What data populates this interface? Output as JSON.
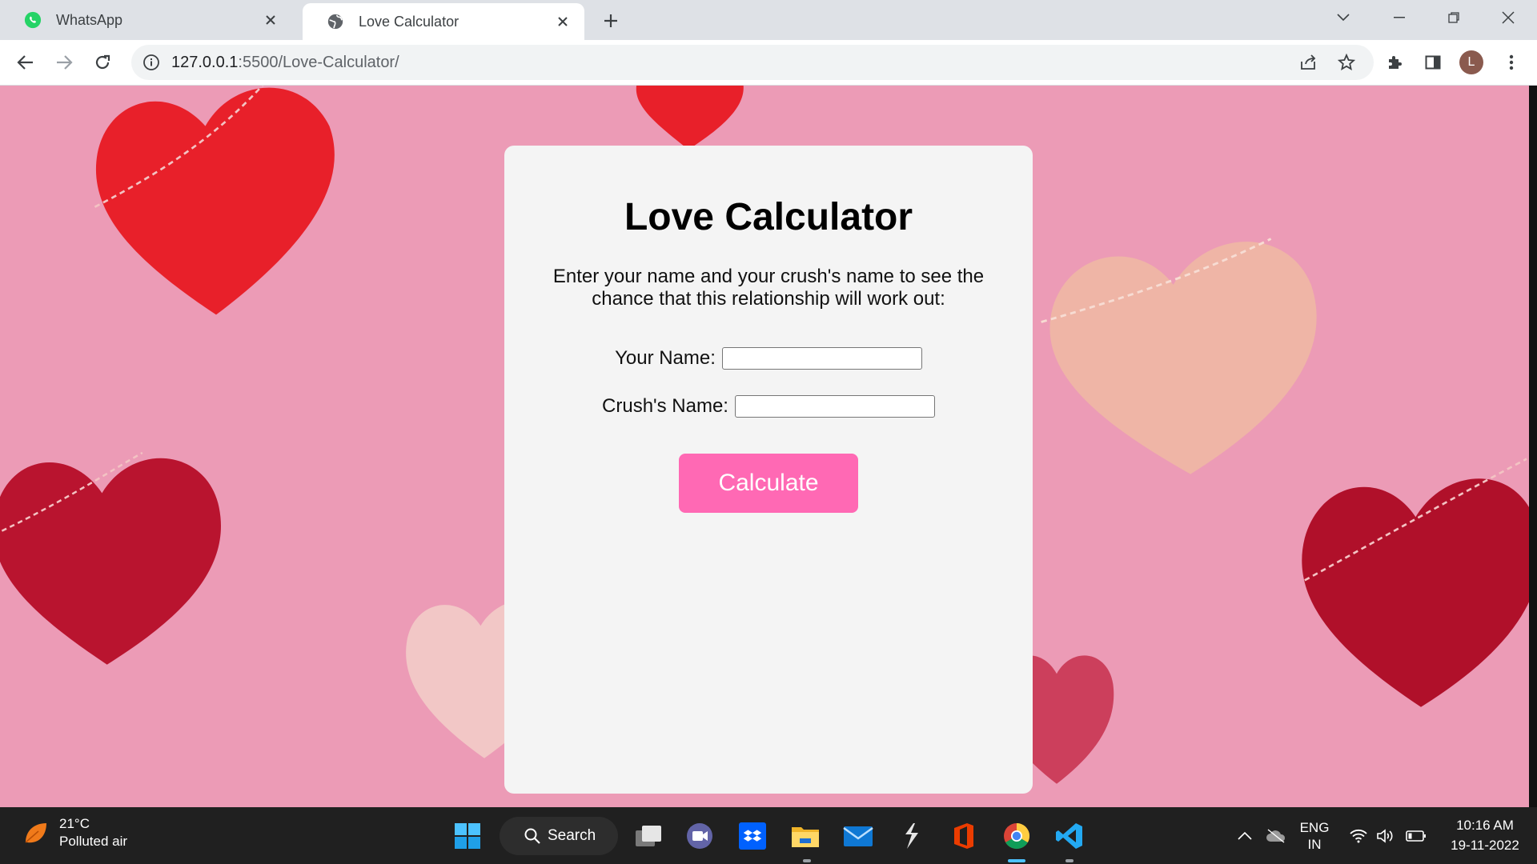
{
  "browser": {
    "tabs": [
      {
        "title": "WhatsApp",
        "active": false,
        "icon": "whatsapp-icon"
      },
      {
        "title": "Love Calculator",
        "active": true,
        "icon": "globe-icon"
      }
    ],
    "url_host": "127.0.0.1",
    "url_rest": ":5500/Love-Calculator/",
    "profile_initial": "L"
  },
  "page": {
    "title": "Love Calculator",
    "description": "Enter your name and your crush's name to see the chance that this relationship will work out:",
    "your_name_label": "Your Name:",
    "your_name_value": "",
    "crush_name_label": "Crush's Name:",
    "crush_name_value": "",
    "button_label": "Calculate",
    "colors": {
      "background": "#ec9bb6",
      "card": "#f4f4f4",
      "button": "#ff69b4"
    }
  },
  "taskbar": {
    "weather_temp": "21°C",
    "weather_condition": "Polluted air",
    "search_label": "Search",
    "lang_line1": "ENG",
    "lang_line2": "IN",
    "time": "10:16 AM",
    "date": "19-11-2022"
  }
}
